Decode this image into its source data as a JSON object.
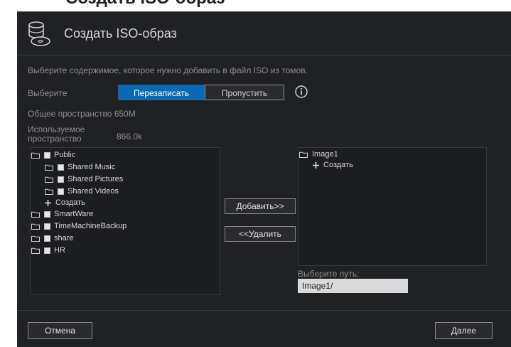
{
  "page_heading": "Создать ISO-образ",
  "dialog": {
    "title": "Создать ISO-образ",
    "instruction": "Выберите содержимое, которое нужно добавить в файл ISO из томов.",
    "select_label": "Выберите",
    "mode_options": {
      "overwrite": "Перезаписать",
      "skip": "Пропустить"
    },
    "selected_mode": "overwrite",
    "total_space": "Общее пространство 650M",
    "used_space_label_line1": "Используемое",
    "used_space_label_line2": "пространство",
    "used_space_value": "866.0k"
  },
  "source_tree": [
    {
      "label": "Public"
    },
    {
      "label": "Shared Music"
    },
    {
      "label": "Shared Pictures"
    },
    {
      "label": "Shared Videos"
    },
    {
      "label": "Создать"
    },
    {
      "label": "SmartWare"
    },
    {
      "label": "TimeMachineBackup"
    },
    {
      "label": "share"
    },
    {
      "label": "HR"
    }
  ],
  "buttons": {
    "add": "Добавить>>",
    "remove": "<<Удалить",
    "cancel": "Отмена",
    "next": "Далее"
  },
  "target_tree": [
    {
      "label": "Image1"
    },
    {
      "label": "Создать"
    }
  ],
  "path": {
    "label": "Выберите путь:",
    "value": "Image1/"
  },
  "colors": {
    "dialog_bg": "#202124",
    "accent": "#0a69b0",
    "text_muted": "#8f8f8f"
  }
}
